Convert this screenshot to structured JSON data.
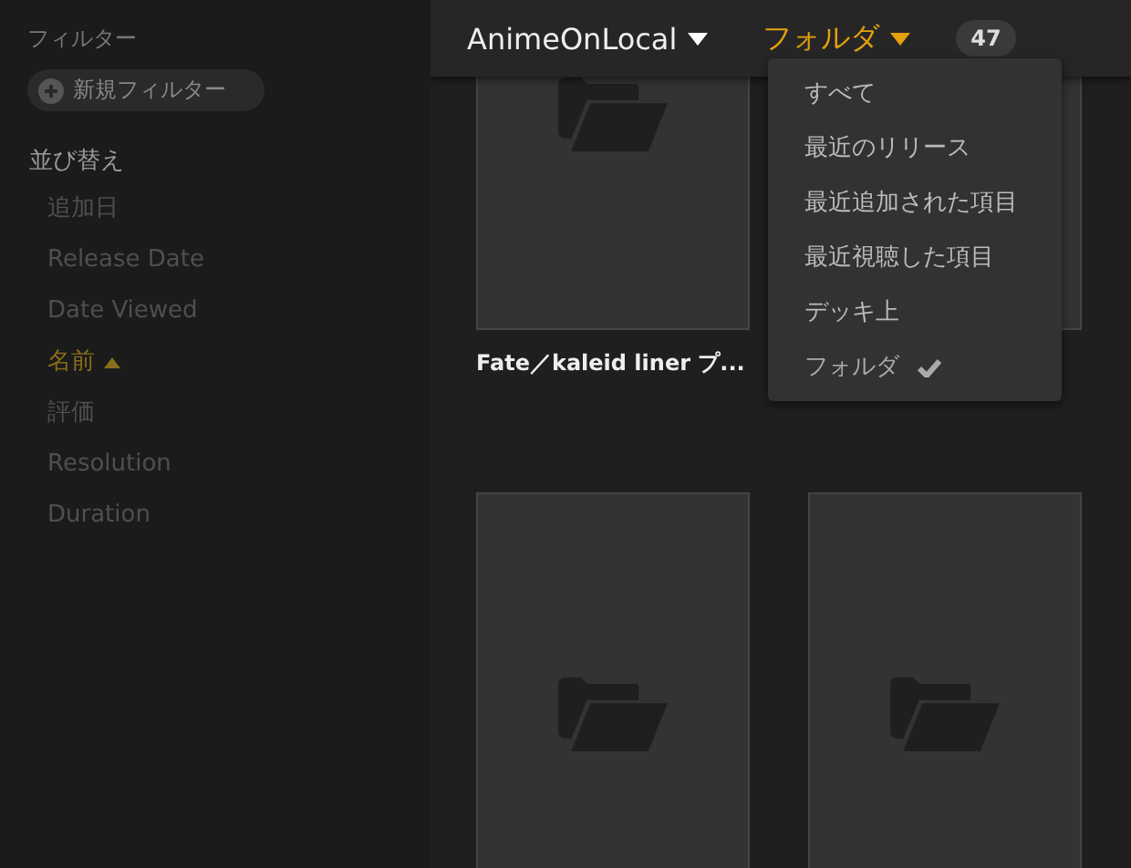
{
  "sidebar": {
    "filters_heading": "フィルター",
    "new_filter_button": "新規フィルター",
    "sort_heading": "並び替え",
    "sort_items": [
      {
        "label": "追加日",
        "selected": false
      },
      {
        "label": "Release Date",
        "selected": false
      },
      {
        "label": "Date Viewed",
        "selected": false
      },
      {
        "label": "名前",
        "selected": true,
        "ascending": true
      },
      {
        "label": "評価",
        "selected": false
      },
      {
        "label": "Resolution",
        "selected": false
      },
      {
        "label": "Duration",
        "selected": false
      }
    ]
  },
  "top_bar": {
    "library": "AnimeOnLocal",
    "view": "フォルダ",
    "count": "47"
  },
  "view_menu": {
    "items": [
      {
        "label": "すべて",
        "selected": false
      },
      {
        "label": "最近のリリース",
        "selected": false
      },
      {
        "label": "最近追加された項目",
        "selected": false
      },
      {
        "label": "最近視聴した項目",
        "selected": false
      },
      {
        "label": "デッキ上",
        "selected": false
      },
      {
        "label": "フォルダ",
        "selected": true
      }
    ]
  },
  "items": [
    {
      "kind": "folder",
      "title": "Fate／kaleid liner プ..."
    },
    {
      "kind": "covered"
    },
    {
      "kind": "folder"
    },
    {
      "kind": "folder"
    }
  ]
}
